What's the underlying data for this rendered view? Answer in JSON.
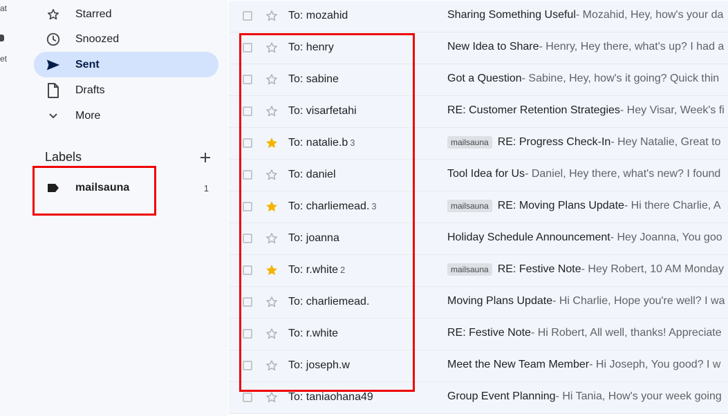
{
  "rail": {
    "items": [
      "at",
      "et"
    ]
  },
  "sidebar": {
    "nav": [
      {
        "label": "Starred",
        "icon": "star-icon"
      },
      {
        "label": "Snoozed",
        "icon": "clock-icon"
      },
      {
        "label": "Sent",
        "icon": "send-icon",
        "active": true
      },
      {
        "label": "Drafts",
        "icon": "draft-icon"
      },
      {
        "label": "More",
        "icon": "chevron-down-icon"
      }
    ],
    "labels_title": "Labels",
    "labels": [
      {
        "name": "mailsauna",
        "count": "1",
        "icon": "label-tag-icon"
      }
    ]
  },
  "mail_list": [
    {
      "recipient": "To: mozahid",
      "count": "",
      "starred": false,
      "label": "",
      "subject": "Sharing Something Useful",
      "snippet": " - Mozahid, Hey, how's your da"
    },
    {
      "recipient": "To: henry",
      "count": "",
      "starred": false,
      "label": "",
      "subject": "New Idea to Share",
      "snippet": " - Henry, Hey there, what's up? I had a"
    },
    {
      "recipient": "To: sabine",
      "count": "",
      "starred": false,
      "label": "",
      "subject": "Got a Question",
      "snippet": " - Sabine, Hey, how's it going? Quick thin"
    },
    {
      "recipient": "To: visarfetahi",
      "count": "",
      "starred": false,
      "label": "",
      "subject": "RE: Customer Retention Strategies",
      "snippet": " - Hey Visar, Week's fi"
    },
    {
      "recipient": "To: natalie.b",
      "count": "3",
      "starred": true,
      "label": "mailsauna",
      "subject": "RE: Progress Check-In",
      "snippet": " - Hey Natalie, Great to"
    },
    {
      "recipient": "To: daniel",
      "count": "",
      "starred": false,
      "label": "",
      "subject": "Tool Idea for Us",
      "snippet": " - Daniel, Hey there, what's new? I found"
    },
    {
      "recipient": "To: charliemead.",
      "count": "3",
      "starred": true,
      "label": "mailsauna",
      "subject": "RE: Moving Plans Update",
      "snippet": " - Hi there Charlie, A"
    },
    {
      "recipient": "To: joanna",
      "count": "",
      "starred": false,
      "label": "",
      "subject": "Holiday Schedule Announcement",
      "snippet": " - Hey Joanna, You goo"
    },
    {
      "recipient": "To: r.white",
      "count": "2",
      "starred": true,
      "label": "mailsauna",
      "subject": "RE: Festive Note",
      "snippet": " - Hey Robert, 10 AM Monday"
    },
    {
      "recipient": "To: charliemead.",
      "count": "",
      "starred": false,
      "label": "",
      "subject": "Moving Plans Update",
      "snippet": " - Hi Charlie, Hope you're well? I wa"
    },
    {
      "recipient": "To: r.white",
      "count": "",
      "starred": false,
      "label": "",
      "subject": "RE: Festive Note",
      "snippet": " - Hi Robert, All well, thanks! Appreciate"
    },
    {
      "recipient": "To: joseph.w",
      "count": "",
      "starred": false,
      "label": "",
      "subject": "Meet the New Team Member",
      "snippet": " - Hi Joseph, You good? I w"
    },
    {
      "recipient": "To: taniaohana49",
      "count": "",
      "starred": false,
      "label": "",
      "subject": "Group Event Planning",
      "snippet": " - Hi Tania, How's your week going"
    }
  ],
  "colors": {
    "highlight": "#ee0000",
    "active_nav_bg": "#d3e3fd",
    "star_filled": "#f4b400",
    "row_bg": "#f2f6fc"
  }
}
